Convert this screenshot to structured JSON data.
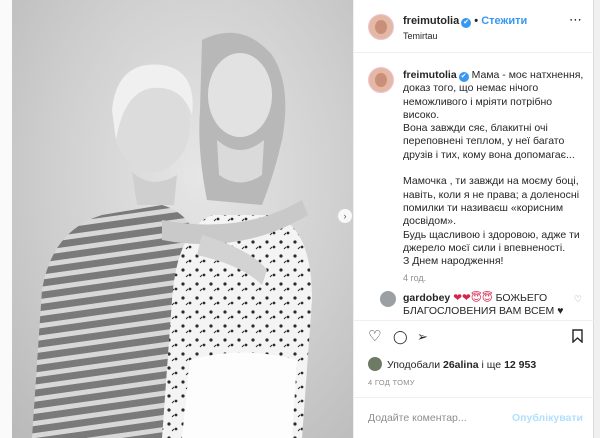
{
  "post": {
    "username": "freimutolia",
    "verified_mark": "✔",
    "follow_label": "Стежити",
    "location": "Temirtau",
    "more_icon": "⋯"
  },
  "caption": {
    "username": "freimutolia",
    "lines": [
      "Мама - моє натхнення,",
      "доказ того, що немає нічого",
      "неможливого і мріяти потрібно",
      "високо.",
      "Вона завжди сяє, блакитні очі",
      "переповнені теплом, у неї багато",
      "друзів і тих, кому вона допомагає...",
      "",
      "Мамочка , ти завжди на моєму боці,",
      "навіть, коли я не права; а доленосні",
      "помилки ти називаєш «корисним",
      "досвідом».",
      "Будь щасливою і здоровою, адже ти",
      "джерело моєї сили і впевненості.",
      "З Днем народження!"
    ],
    "first_line_rest": "Мама - моє натхнення,",
    "time_ago": "4 год."
  },
  "comment": {
    "username": "gardobey",
    "emoji": "❤❤😇😇",
    "text_line1": "БОЖЬЕГО",
    "text_line2": "БЛАГОСЛОВЕНИЯ ВАМ ВСЕМ ♥",
    "like_icon": "♡"
  },
  "actions": {
    "like_icon": "♡",
    "comment_icon": "◯",
    "share_icon": "➢",
    "save_icon": "🔖"
  },
  "likes": {
    "prefix": "Уподобали",
    "user": "26alina",
    "middle": "і ще",
    "count": "12 953"
  },
  "posted_at": "4 ГОД ТОМУ",
  "comment_box": {
    "placeholder": "Додайте коментар...",
    "publish_label": "Опублікувати"
  },
  "photo": {
    "next_icon": "›"
  }
}
